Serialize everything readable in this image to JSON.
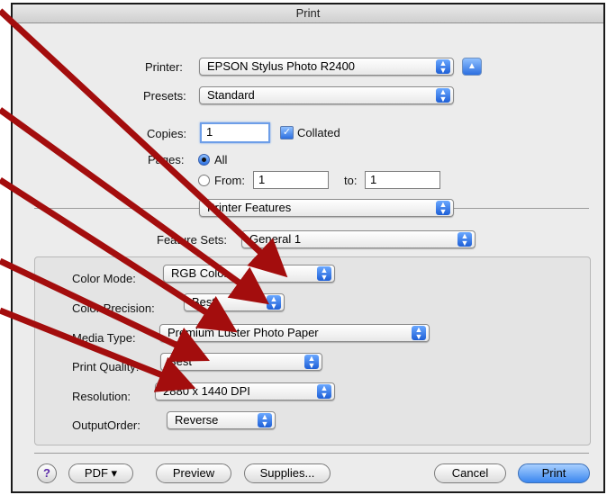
{
  "window": {
    "title": "Print"
  },
  "printer": {
    "label": "Printer:",
    "value": "EPSON Stylus Photo R2400"
  },
  "presets": {
    "label": "Presets:",
    "value": "Standard"
  },
  "copies": {
    "label": "Copies:",
    "value": "1",
    "collated_label": "Collated",
    "collated": true
  },
  "pages": {
    "label": "Pages:",
    "all_label": "All",
    "from_label": "From:",
    "from_value": "1",
    "to_label": "to:",
    "to_value": "1",
    "selected": "All"
  },
  "section_menu": {
    "value": "Printer Features"
  },
  "feature_sets": {
    "label": "Feature Sets:",
    "value": "General 1"
  },
  "settings": [
    {
      "label": "Color Mode:",
      "value": "RGB Color"
    },
    {
      "label": "Color Precision:",
      "value": "Best"
    },
    {
      "label": "Media Type:",
      "value": "Premium Luster Photo Paper"
    },
    {
      "label": "Print Quality:",
      "value": "Best"
    },
    {
      "label": "Resolution:",
      "value": "2880 x 1440 DPI"
    },
    {
      "label": "OutputOrder:",
      "value": "Reverse"
    }
  ],
  "buttons": {
    "help": "?",
    "pdf": "PDF ▾",
    "preview": "Preview",
    "supplies": "Supplies...",
    "cancel": "Cancel",
    "print": "Print"
  },
  "icons": {
    "popup_arrows": "up-down-arrows-icon",
    "disclosure": "triangle-up-icon",
    "annotation": "red-arrow-icon"
  },
  "colors": {
    "annotation_arrow": "#a30d0d",
    "accent": "#2c6fe0"
  }
}
